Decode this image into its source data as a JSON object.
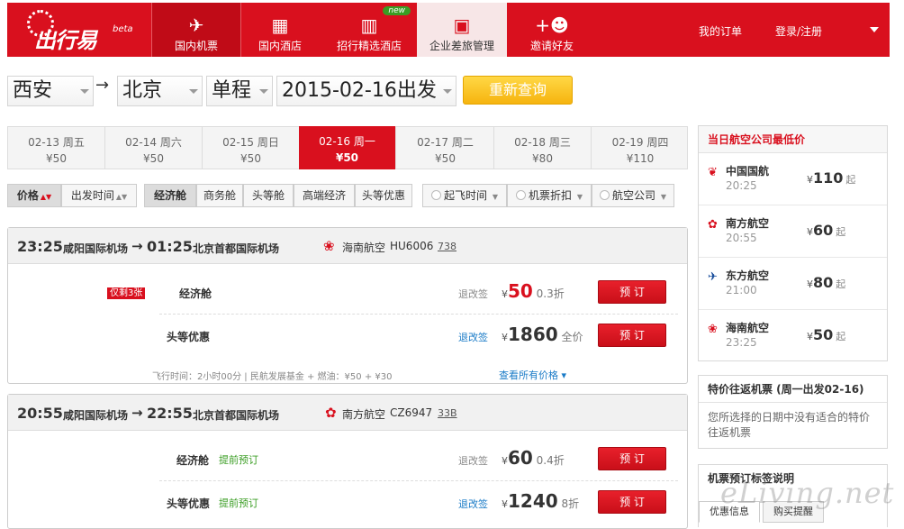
{
  "brand": {
    "logo_text": "出行易",
    "beta": "beta"
  },
  "nav": {
    "tabs": [
      {
        "label": "国内机票",
        "icon": "airplane-icon"
      },
      {
        "label": "国内酒店",
        "icon": "building-icon"
      },
      {
        "label": "招行精选酒店",
        "icon": "city-icon",
        "badge": "new"
      },
      {
        "label": "企业差旅管理",
        "icon": "suitcase-icon"
      },
      {
        "label": "邀请好友",
        "icon": "add-user-icon"
      }
    ],
    "my_orders": "我的订单",
    "login": "登录/注册"
  },
  "search": {
    "from": "西安",
    "to": "北京",
    "trip_type": "单程",
    "date": "2015-02-16出发",
    "button": "重新查询"
  },
  "dates": [
    {
      "date": "02-13 周五",
      "price": "¥50"
    },
    {
      "date": "02-14 周六",
      "price": "¥50"
    },
    {
      "date": "02-15 周日",
      "price": "¥50"
    },
    {
      "date": "02-16 周一",
      "price": "¥50",
      "selected": true
    },
    {
      "date": "02-17 周二",
      "price": "¥50"
    },
    {
      "date": "02-18 周三",
      "price": "¥80"
    },
    {
      "date": "02-19 周四",
      "price": "¥110"
    }
  ],
  "sort": {
    "price": "价格",
    "time": "出发时间"
  },
  "cabins": [
    "经济舱",
    "商务舱",
    "头等舱",
    "高端经济",
    "头等优惠"
  ],
  "filters": {
    "takeoff": "起飞时间",
    "discount": "机票折扣",
    "airline": "航空公司"
  },
  "flights": [
    {
      "dep_time": "23:25",
      "dep_airport": "咸阳国际机场",
      "arrow": "→",
      "arr_time": "01:25",
      "arr_airport": "北京首都国际机场",
      "airline": "海南航空",
      "flight_no": "HU6006",
      "plane": "738",
      "fares": [
        {
          "tag": "仅剩3张",
          "cabin": "经济舱",
          "rule": "退改签",
          "yen": "¥",
          "price": "50",
          "discount": "0.3折",
          "book": "预 订"
        },
        {
          "cabin": "头等优惠",
          "rule": "退改签",
          "yen": "¥",
          "price": "1860",
          "discount": "全价",
          "book": "预 订"
        }
      ],
      "footer": "飞行时间：2小时00分 | 民航发展基金 + 燃油：¥50 + ¥30",
      "more": "查看所有价格 ▾"
    },
    {
      "dep_time": "20:55",
      "dep_airport": "咸阳国际机场",
      "arrow": "→",
      "arr_time": "22:55",
      "arr_airport": "北京首都国际机场",
      "airline": "南方航空",
      "flight_no": "CZ6947",
      "plane": "33B",
      "fares": [
        {
          "cabin": "经济舱",
          "advance": "提前预订",
          "rule": "退改签",
          "yen": "¥",
          "price": "60",
          "discount": "0.4折",
          "book": "预 订"
        },
        {
          "cabin": "头等优惠",
          "advance": "提前预订",
          "rule": "退改签",
          "yen": "¥",
          "price": "1240",
          "discount": "8折",
          "book": "预 订"
        }
      ]
    }
  ],
  "sidebar": {
    "lowest_title": "当日航空公司最低价",
    "lowest": [
      {
        "airline": "中国国航",
        "time": "20:25",
        "yen": "¥",
        "price": "110",
        "suffix": "起"
      },
      {
        "airline": "南方航空",
        "time": "20:55",
        "yen": "¥",
        "price": "60",
        "suffix": "起"
      },
      {
        "airline": "东方航空",
        "time": "21:00",
        "yen": "¥",
        "price": "80",
        "suffix": "起"
      },
      {
        "airline": "海南航空",
        "time": "23:25",
        "yen": "¥",
        "price": "50",
        "suffix": "起"
      }
    ],
    "roundtrip_title": "特价往返机票 (周一出发02-16)",
    "roundtrip_text": "您所选择的日期中没有适合的特价往返机票",
    "guide_title": "机票预订标签说明",
    "guide_tabs": [
      "优惠信息",
      "购买提醒"
    ]
  },
  "watermark": "eLiving.net",
  "colors": {
    "brand_red": "#d9101e",
    "search_yellow": "#f6b40f",
    "link_blue": "#1a7bc7",
    "advance_green": "#3a9d23"
  }
}
